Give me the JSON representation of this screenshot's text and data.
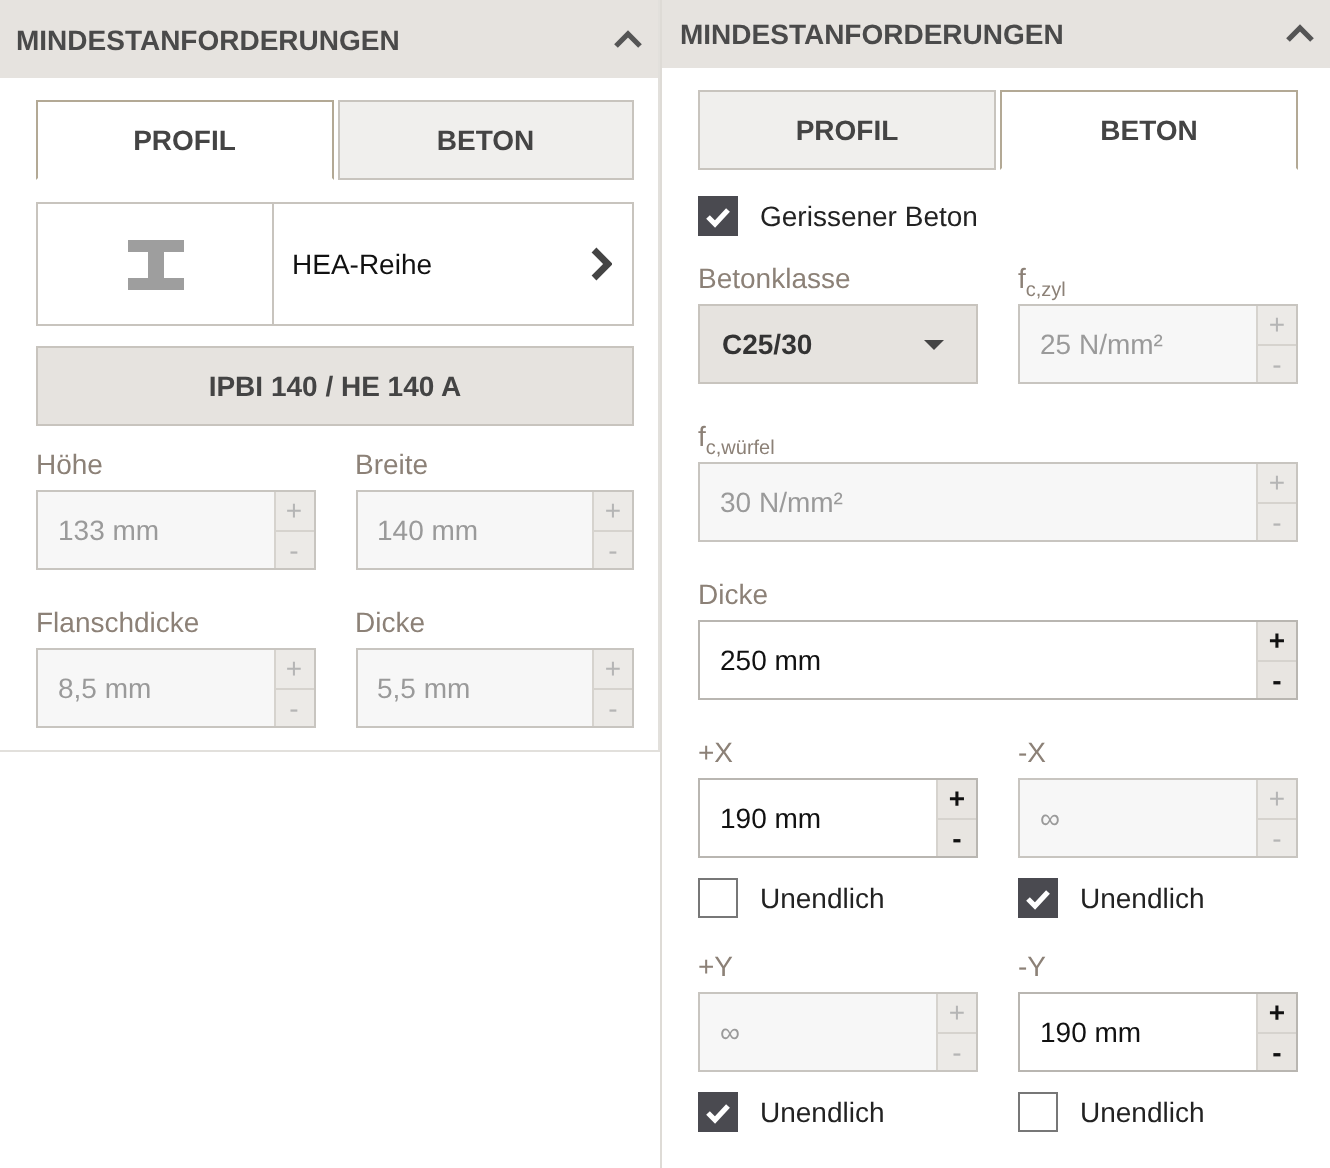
{
  "panels": [
    {
      "title": "MINDESTANFORDERUNGEN",
      "tabs": [
        {
          "label": "PROFIL",
          "selected": true
        },
        {
          "label": "BETON",
          "selected": false
        }
      ],
      "content": [
        {
          "kind": "profile-picker",
          "label": "HEA-Reihe"
        },
        {
          "kind": "action-button",
          "label": "IPBI 140 / HE 140 A"
        },
        {
          "kind": "row",
          "cells": [
            {
              "kind": "field",
              "label": "Höhe",
              "value": "133 mm",
              "disabled": true,
              "plus": "+",
              "minus": "-"
            },
            {
              "kind": "field",
              "label": "Breite",
              "value": "140 mm",
              "disabled": true,
              "plus": "+",
              "minus": "-"
            }
          ]
        },
        {
          "kind": "row",
          "cells": [
            {
              "kind": "field",
              "label": "Flanschdicke",
              "value": "8,5 mm",
              "disabled": true,
              "plus": "+",
              "minus": "-"
            },
            {
              "kind": "field",
              "label": "Dicke",
              "value": "5,5 mm",
              "disabled": true,
              "plus": "+",
              "minus": "-"
            }
          ]
        }
      ]
    },
    {
      "title": "MINDESTANFORDERUNGEN",
      "tabs": [
        {
          "label": "PROFIL",
          "selected": false
        },
        {
          "label": "BETON",
          "selected": true
        }
      ],
      "content": [
        {
          "kind": "checkbox",
          "label": "Gerissener Beton",
          "checked": true
        },
        {
          "kind": "row",
          "cells": [
            {
              "kind": "select",
              "label": "Betonklasse",
              "value": "C25/30"
            },
            {
              "kind": "field",
              "label": "f$_{c,zyl}$",
              "value": "25 N/mm²",
              "disabled": true,
              "plus": "+",
              "minus": "-"
            }
          ]
        },
        {
          "kind": "row",
          "cells": [
            {
              "kind": "field",
              "label": "f$_{c,würfel}$",
              "value": "30 N/mm²",
              "disabled": true,
              "plus": "+",
              "minus": "-"
            }
          ]
        },
        {
          "kind": "row",
          "cells": [
            {
              "kind": "field",
              "label": "Dicke",
              "value": "250 mm",
              "disabled": false,
              "plus": "+",
              "minus": "-"
            }
          ]
        },
        {
          "kind": "row",
          "cells": [
            {
              "kind": "field",
              "label": "+X",
              "value": "190 mm",
              "disabled": false,
              "plus": "+",
              "minus": "-"
            },
            {
              "kind": "field",
              "label": "-X",
              "value": "∞",
              "disabled": true,
              "plus": "+",
              "minus": "-"
            }
          ]
        },
        {
          "kind": "row",
          "cells": [
            {
              "kind": "checkbox",
              "label": "Unendlich",
              "checked": false
            },
            {
              "kind": "checkbox",
              "label": "Unendlich",
              "checked": true
            }
          ]
        },
        {
          "kind": "row",
          "cells": [
            {
              "kind": "field",
              "label": "+Y",
              "value": "∞",
              "disabled": true,
              "plus": "+",
              "minus": "-"
            },
            {
              "kind": "field",
              "label": "-Y",
              "value": "190 mm",
              "disabled": false,
              "plus": "+",
              "minus": "-"
            }
          ]
        },
        {
          "kind": "row",
          "cells": [
            {
              "kind": "checkbox",
              "label": "Unendlich",
              "checked": true
            },
            {
              "kind": "checkbox",
              "label": "Unendlich",
              "checked": false
            }
          ]
        }
      ]
    }
  ]
}
